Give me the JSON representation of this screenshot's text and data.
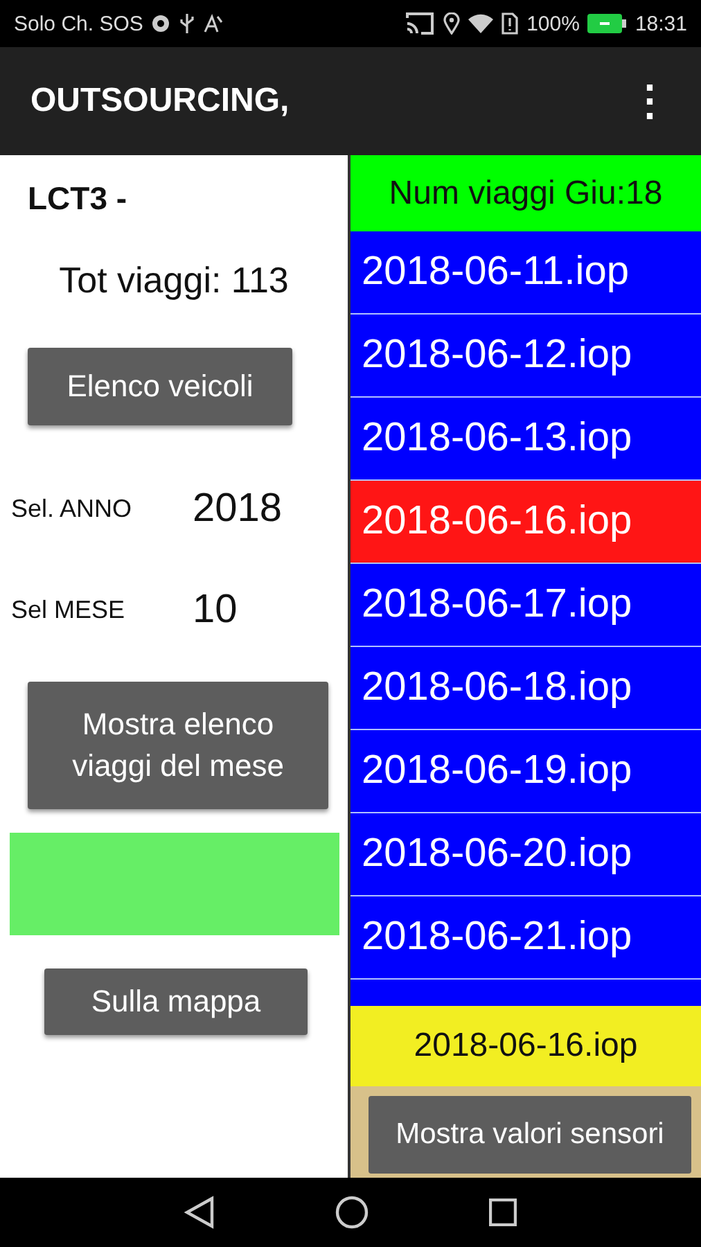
{
  "status_bar": {
    "carrier": "Solo Ch. SOS",
    "battery": "100%",
    "time": "18:31"
  },
  "app_bar": {
    "title": "OUTSOURCING,",
    "menu": "⋮"
  },
  "left_panel": {
    "vehicle": "LCT3 -",
    "total_trips": "Tot viaggi: 113",
    "vehicles_button": "Elenco veicoli",
    "year_label": "Sel. ANNO",
    "year_value": "2018",
    "month_label": "Sel MESE",
    "month_value": "10",
    "show_trips_button": "Mostra elenco viaggi del mese",
    "map_button": "Sulla mappa"
  },
  "trip_list": {
    "header": "Num viaggi Giu:18",
    "rows": [
      {
        "label": "2018-06-11.iop",
        "selected": false
      },
      {
        "label": "2018-06-12.iop",
        "selected": false
      },
      {
        "label": "2018-06-13.iop",
        "selected": false
      },
      {
        "label": "2018-06-16.iop",
        "selected": true
      },
      {
        "label": "2018-06-17.iop",
        "selected": false
      },
      {
        "label": "2018-06-18.iop",
        "selected": false
      },
      {
        "label": "2018-06-19.iop",
        "selected": false
      },
      {
        "label": "2018-06-20.iop",
        "selected": false
      },
      {
        "label": "2018-06-21.iop",
        "selected": false
      }
    ],
    "selected_file": "2018-06-16.iop",
    "sensors_button": "Mostra valori sensori"
  }
}
